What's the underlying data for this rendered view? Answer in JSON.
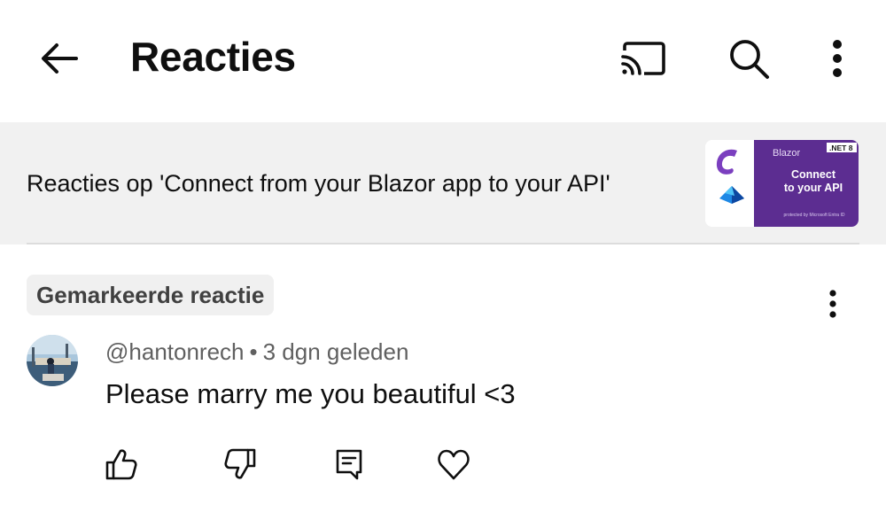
{
  "header": {
    "title": "Reacties",
    "icons": {
      "back": "back-arrow-icon",
      "cast": "cast-icon",
      "search": "search-icon",
      "more": "more-vertical-icon"
    }
  },
  "video": {
    "comments_on_label": "Reacties op 'Connect from your Blazor app to your API'",
    "thumbnail": {
      "brand": "Blazor",
      "version_badge": ".NET 8",
      "headline_line1": "Connect",
      "headline_line2": "to your API",
      "footer": "protected by Microsoft Entra ID",
      "accent_color": "#5c2d91"
    }
  },
  "comment": {
    "pinned_label": "Gemarkeerde reactie",
    "author": "@hantonrech",
    "separator": "•",
    "time": "3 dgn geleden",
    "text": "Please marry me you beautiful <3",
    "actions": {
      "like": "thumbs-up-icon",
      "dislike": "thumbs-down-icon",
      "reply": "reply-icon",
      "heart": "heart-icon"
    }
  },
  "colors": {
    "banner_bg": "#f1f1f1",
    "text_primary": "#0f0f0f",
    "text_secondary": "#606060"
  }
}
